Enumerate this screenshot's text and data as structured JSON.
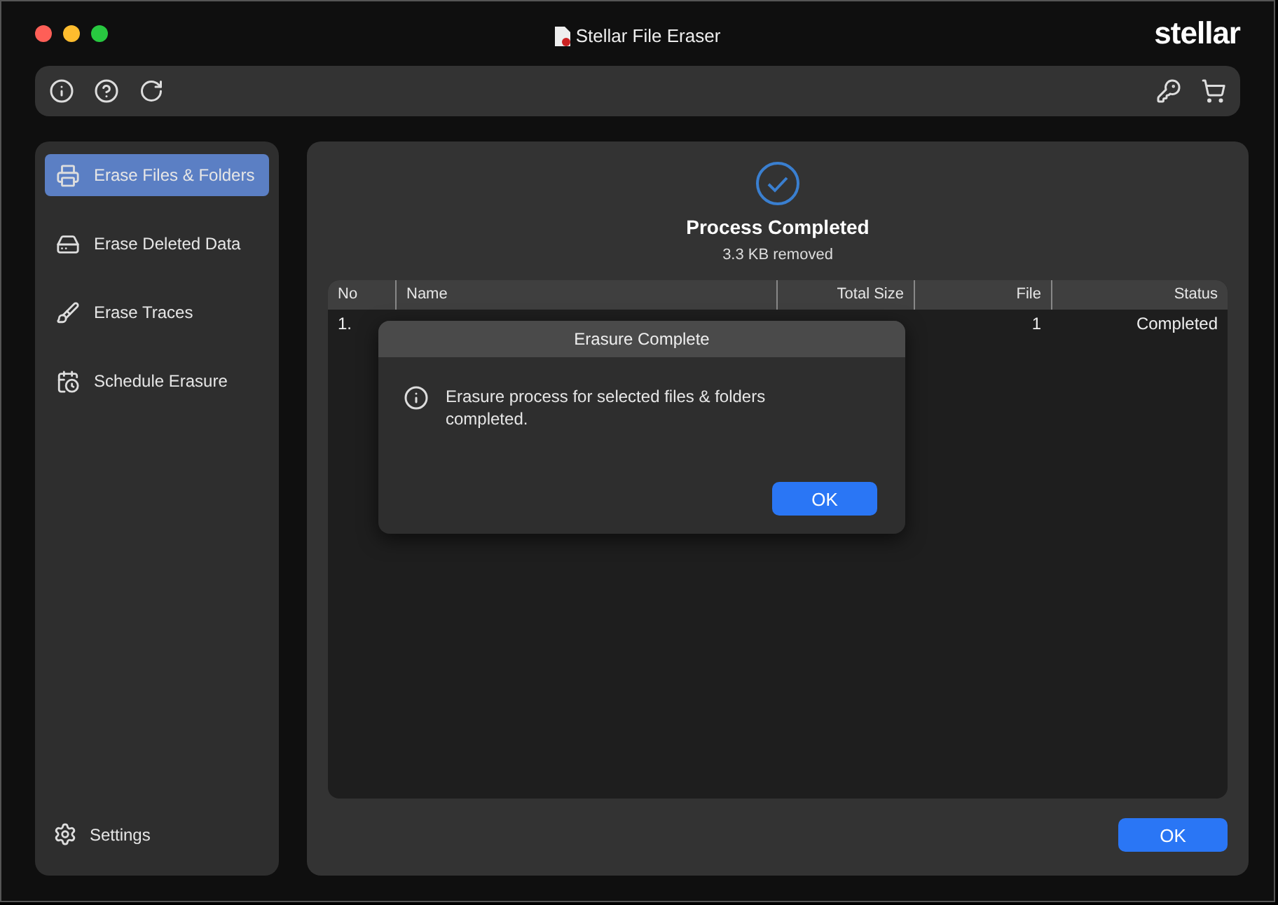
{
  "window": {
    "title": "Stellar File Eraser",
    "logo": "stellar"
  },
  "sidebar": {
    "items": [
      {
        "label": "Erase Files & Folders",
        "selected": true
      },
      {
        "label": "Erase Deleted Data",
        "selected": false
      },
      {
        "label": "Erase Traces",
        "selected": false
      },
      {
        "label": "Schedule Erasure",
        "selected": false
      }
    ],
    "settings": "Settings"
  },
  "result": {
    "title": "Process Completed",
    "subtitle": "3.3 KB removed"
  },
  "table": {
    "columns": [
      "No",
      "Name",
      "Total Size",
      "File",
      "Status"
    ],
    "rows": [
      {
        "no": "1.",
        "file": "1",
        "status": "Completed"
      }
    ]
  },
  "dialog": {
    "title": "Erasure Complete",
    "message": "Erasure process for selected files & folders completed.",
    "button": "OK"
  },
  "ok_button": "OK"
}
